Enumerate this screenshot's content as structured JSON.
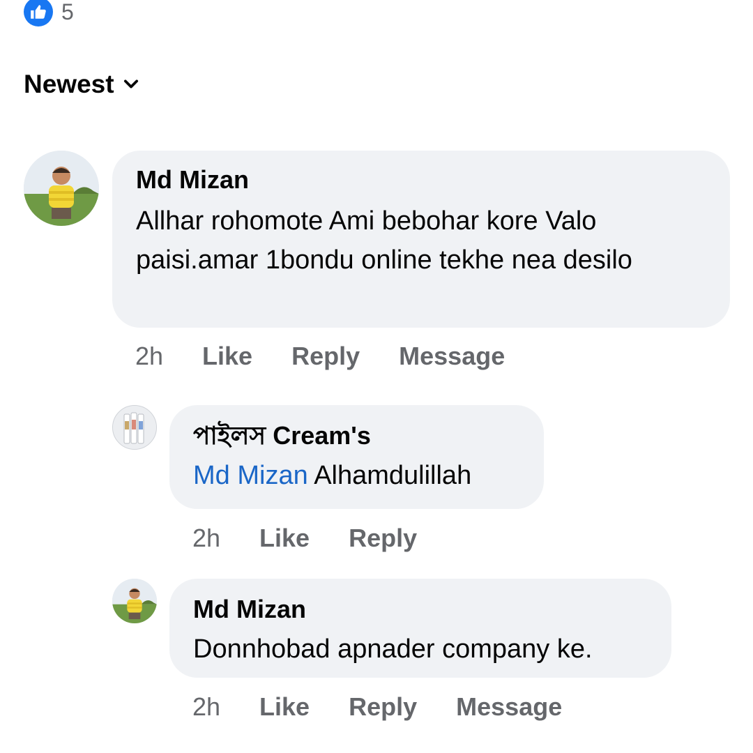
{
  "reactions": {
    "icon": "like-icon",
    "count": "5",
    "color": "#1877f2"
  },
  "sort": {
    "label": "Newest",
    "icon": "chevron-down-icon"
  },
  "comments": [
    {
      "author": "Md Mizan",
      "text": "Allhar rohomote Ami bebohar kore Valo paisi.amar 1bondu online tekhe  nea desilo",
      "time": "2h",
      "actions": [
        "Like",
        "Reply",
        "Message"
      ]
    },
    {
      "author": "পাইলস Cream's",
      "mention": "Md Mizan",
      "text": "Alhamdulillah",
      "time": "2h",
      "actions": [
        "Like",
        "Reply"
      ]
    },
    {
      "author": "Md Mizan",
      "text": "Donnhobad apnader company ke.",
      "time": "2h",
      "actions": [
        "Like",
        "Reply",
        "Message"
      ]
    }
  ],
  "colors": {
    "bubble": "#f0f2f5",
    "mention": "#1a66c7",
    "meta": "#65676b"
  }
}
